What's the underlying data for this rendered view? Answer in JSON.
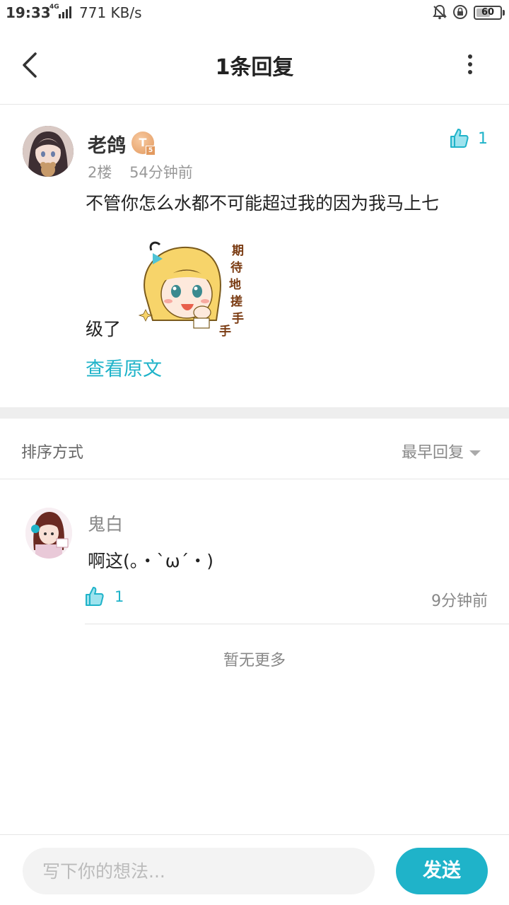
{
  "status_bar": {
    "time": "19:33",
    "network": "4G",
    "speed": "771 KB/s",
    "battery": "60",
    "battery_level": 0.6
  },
  "header": {
    "title": "1条回复"
  },
  "post": {
    "author": "老鸽",
    "level_badge": "T",
    "level_num": "5",
    "likes": "1",
    "floor": "2楼",
    "time": "54分钟前",
    "text_line1": "不管你怎么水都不可能超过我的因为我马上七",
    "text_line2": "级了",
    "view_original": "查看原文",
    "sticker": "期待地搓手手"
  },
  "sort": {
    "label": "排序方式",
    "selected": "最早回复"
  },
  "reply": {
    "author": "鬼白",
    "text": "啊这(。・`ω´・)",
    "likes": "1",
    "time": "9分钟前"
  },
  "footer_note": "暂无更多",
  "composer": {
    "placeholder": "写下你的想法...",
    "send_label": "发送"
  },
  "colors": {
    "accent": "#1fb3c9",
    "badge": "#e39a5f"
  }
}
